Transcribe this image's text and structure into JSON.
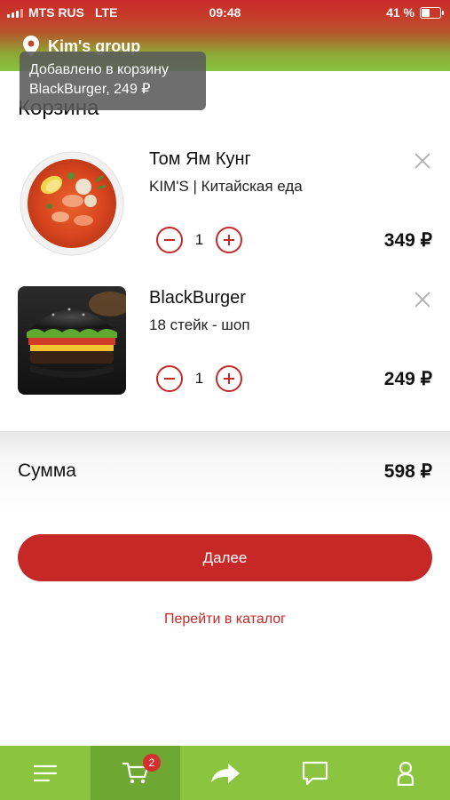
{
  "status_bar": {
    "carrier": "MTS RUS",
    "network": "LTE",
    "time": "09:48",
    "battery": "41 %"
  },
  "header": {
    "location": "Kim's group"
  },
  "toast": {
    "line1": "Добавлено в корзину",
    "line2": "BlackBurger, 249 ₽"
  },
  "page_title": "Корзина",
  "items": [
    {
      "name": "Том Ям Кунг",
      "subtitle": "KIM'S | Китайская еда",
      "quantity": "1",
      "price": "349 ₽",
      "image": "tom-yum-soup"
    },
    {
      "name": "BlackBurger",
      "subtitle": "18 стейк - шоп",
      "quantity": "1",
      "price": "249 ₽",
      "image": "black-burger"
    }
  ],
  "summary": {
    "label": "Сумма",
    "value": "598 ₽"
  },
  "actions": {
    "next_label": "Далее",
    "catalog_link": "Перейти в каталог"
  },
  "tabbar": {
    "tabs": [
      "menu-icon",
      "cart-icon",
      "share-arrow-icon",
      "chat-icon",
      "profile-icon"
    ],
    "cart_badge": "2",
    "active_tab": "cart"
  },
  "colors": {
    "accent": "#c62828",
    "green": "#8bc43f",
    "green_active": "#6ea832"
  }
}
